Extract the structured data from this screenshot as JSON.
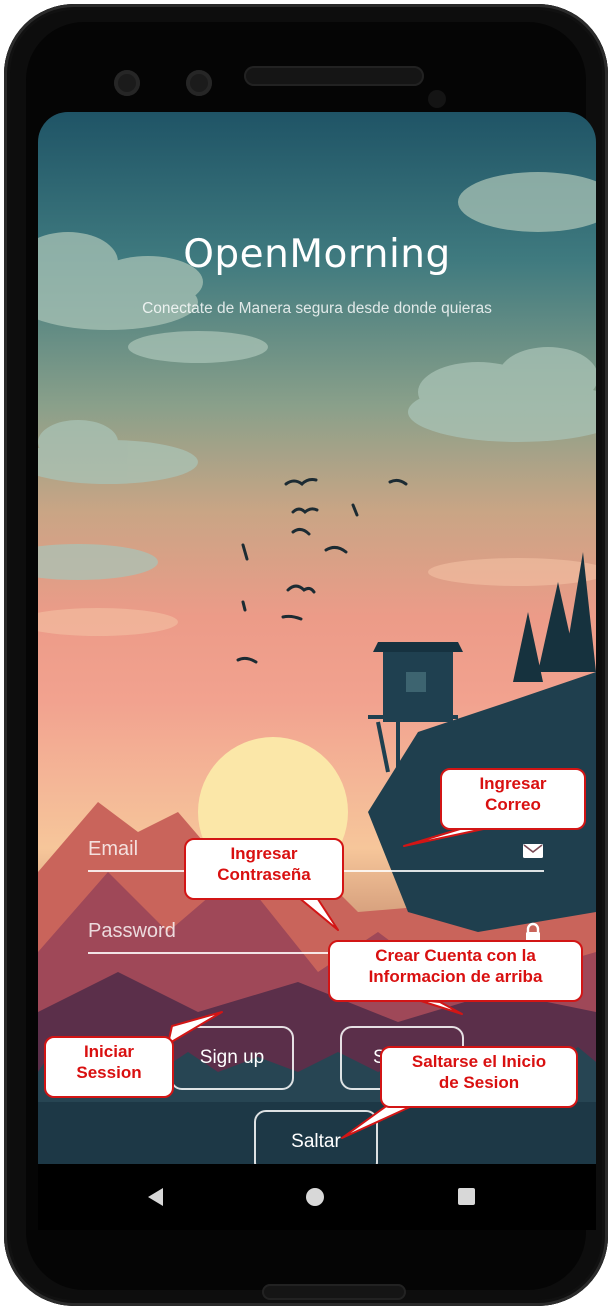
{
  "app": {
    "title": "OpenMorning",
    "subtitle": "Conectate de Manera segura desde donde quieras"
  },
  "form": {
    "email_label": "Email",
    "email_icon": "envelope-icon",
    "password_label": "Password",
    "password_icon": "lock-icon"
  },
  "buttons": {
    "sign_up": "Sign up",
    "sign_in": "Sign in",
    "skip": "Saltar"
  },
  "nav": {
    "back_icon": "back-triangle-icon",
    "home_icon": "home-circle-icon",
    "recent_icon": "recent-square-icon"
  },
  "annotations": {
    "email": "Ingresar\nCorreo",
    "password": "Ingresar\nContraseña",
    "sign_in": "Crear Cuenta con la\nInformacion de arriba",
    "sign_up": "Iniciar\nSession",
    "skip": "Saltarse el Inicio\nde Sesion"
  },
  "colors": {
    "annotation_border": "#d21515",
    "annotation_text": "#d91010",
    "phone_body": "#0d0d0d"
  }
}
